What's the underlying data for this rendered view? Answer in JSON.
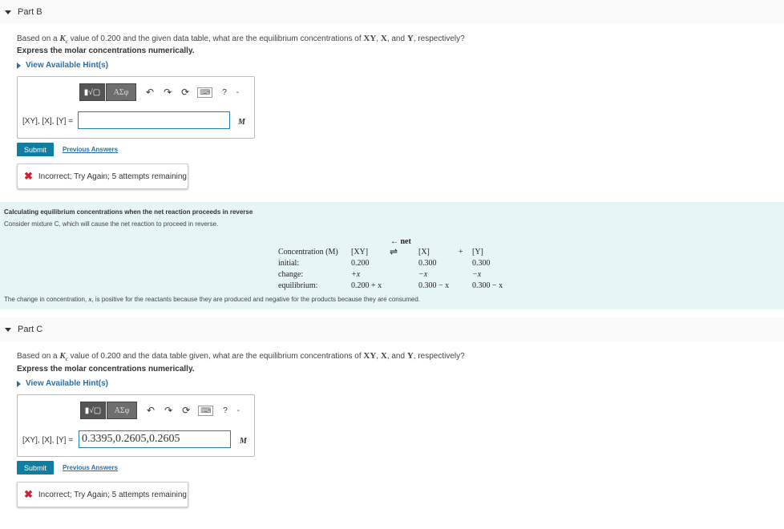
{
  "partB": {
    "title": "Part B",
    "question_prefix": "Based on a ",
    "kc_symbol": "K",
    "kc_sub": "c",
    "question_middle": " value of 0.200 and the given data table, what are the equilibrium concentrations of ",
    "species_xy": "XY",
    "sep1": ", ",
    "species_x": "X",
    "sep2": ", and ",
    "species_y": "Y",
    "question_suffix": ", respectively?",
    "instruction": "Express the molar concentrations numerically.",
    "hint": "View Available Hint(s)",
    "label": "[XY], [X], [Y] =",
    "input_value": "",
    "unit": "M",
    "submit": "Submit",
    "previous": "Previous Answers",
    "feedback": "Incorrect; Try Again; 5 attempts remaining"
  },
  "toolbar": {
    "template_label": "▮√▢",
    "greek_label": "ΑΣφ",
    "undo": "↶",
    "redo": "↷",
    "reset": "⟳",
    "keyboard": "⌨",
    "help": "?",
    "more": "-"
  },
  "info": {
    "title": "Calculating equilibrium concentrations when the net reaction proceeds in reverse",
    "subtitle": "Consider mixture C, which will cause the net reaction to proceed in reverse.",
    "net_label": "← net",
    "arrow": "⇌",
    "plus": "+",
    "headers": [
      "Concentration (M)",
      "[XY]",
      "[X]",
      "[Y]"
    ],
    "rows": [
      {
        "label": "initial:",
        "xy": "0.200",
        "x": "0.300",
        "y": "0.300"
      },
      {
        "label": "change:",
        "xy": "+x",
        "x": "−x",
        "y": "−x"
      },
      {
        "label": "equilibrium:",
        "xy": "0.200 + x",
        "x": "0.300 − x",
        "y": "0.300 − x"
      }
    ],
    "note_prefix": "The change in concentration, ",
    "note_var": "x",
    "note_suffix": ", is positive for the reactants because they are produced and negative for the products because they are consumed."
  },
  "partC": {
    "title": "Part C",
    "question_prefix": "Based on a ",
    "kc_symbol": "K",
    "kc_sub": "c",
    "question_middle": " value of 0.200 and the data table given, what are the equilibrium concentrations of ",
    "species_xy": "XY",
    "sep1": ", ",
    "species_x": "X",
    "sep2": ", and ",
    "species_y": "Y",
    "question_suffix": ", respectively?",
    "instruction": "Express the molar concentrations numerically.",
    "hint": "View Available Hint(s)",
    "label": "[XY], [X], [Y] =",
    "input_value": "0.3395,0.2605,0.2605",
    "unit": "M",
    "submit": "Submit",
    "previous": "Previous Answers",
    "feedback": "Incorrect; Try Again; 5 attempts remaining"
  }
}
